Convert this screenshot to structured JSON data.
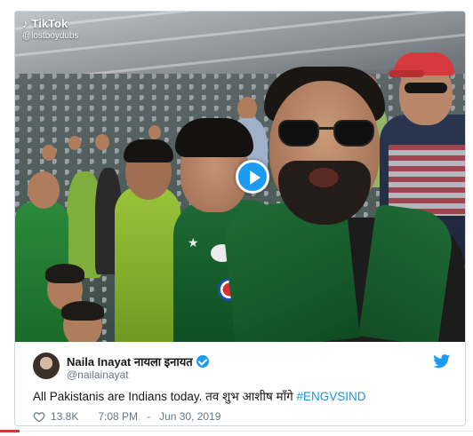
{
  "video": {
    "watermark_app": "TikTok",
    "watermark_user": "@lostboydubs",
    "play_button": "play-icon"
  },
  "tweet": {
    "display_name": "Naila Inayat नायला इनायत",
    "handle": "@nailainayat",
    "text_plain": "All Pakistanis are Indians today. तव शुभ आशीष माँगे ",
    "hashtag": "#ENGVSIND",
    "likes": "13.8K",
    "time": "7:08 PM",
    "separator": "-",
    "date": "Jun 30, 2019"
  },
  "colors": {
    "accent": "#1d9bf0",
    "hashtag": "#1b95e0",
    "meta": "#657786",
    "text": "#14171a",
    "border": "#cfd9de"
  },
  "icons": {
    "verified": "verified-badge-icon",
    "twitter": "twitter-bird-icon",
    "like": "heart-icon",
    "tiktok": "tiktok-note-icon"
  }
}
